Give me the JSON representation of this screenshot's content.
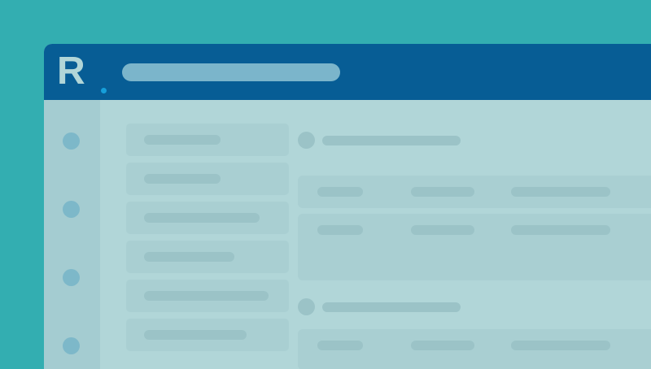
{
  "app": {
    "logo_text": "R",
    "logo_dot_color": "#169fda"
  },
  "colors": {
    "background": "#33aeb1",
    "topbar": "#075d95",
    "content": "#b1d6d8",
    "rail": "#a4ccd1",
    "card": "#a9cfd2",
    "placeholder": "#9bc3c7",
    "search_placeholder": "#7bb5cb",
    "rail_icon": "#7db8c9"
  },
  "icons": {
    "rail": [
      "placeholder-dot-icon",
      "placeholder-dot-icon",
      "placeholder-dot-icon",
      "placeholder-dot-icon"
    ],
    "sections": [
      "placeholder-dot-icon",
      "placeholder-dot-icon"
    ]
  }
}
